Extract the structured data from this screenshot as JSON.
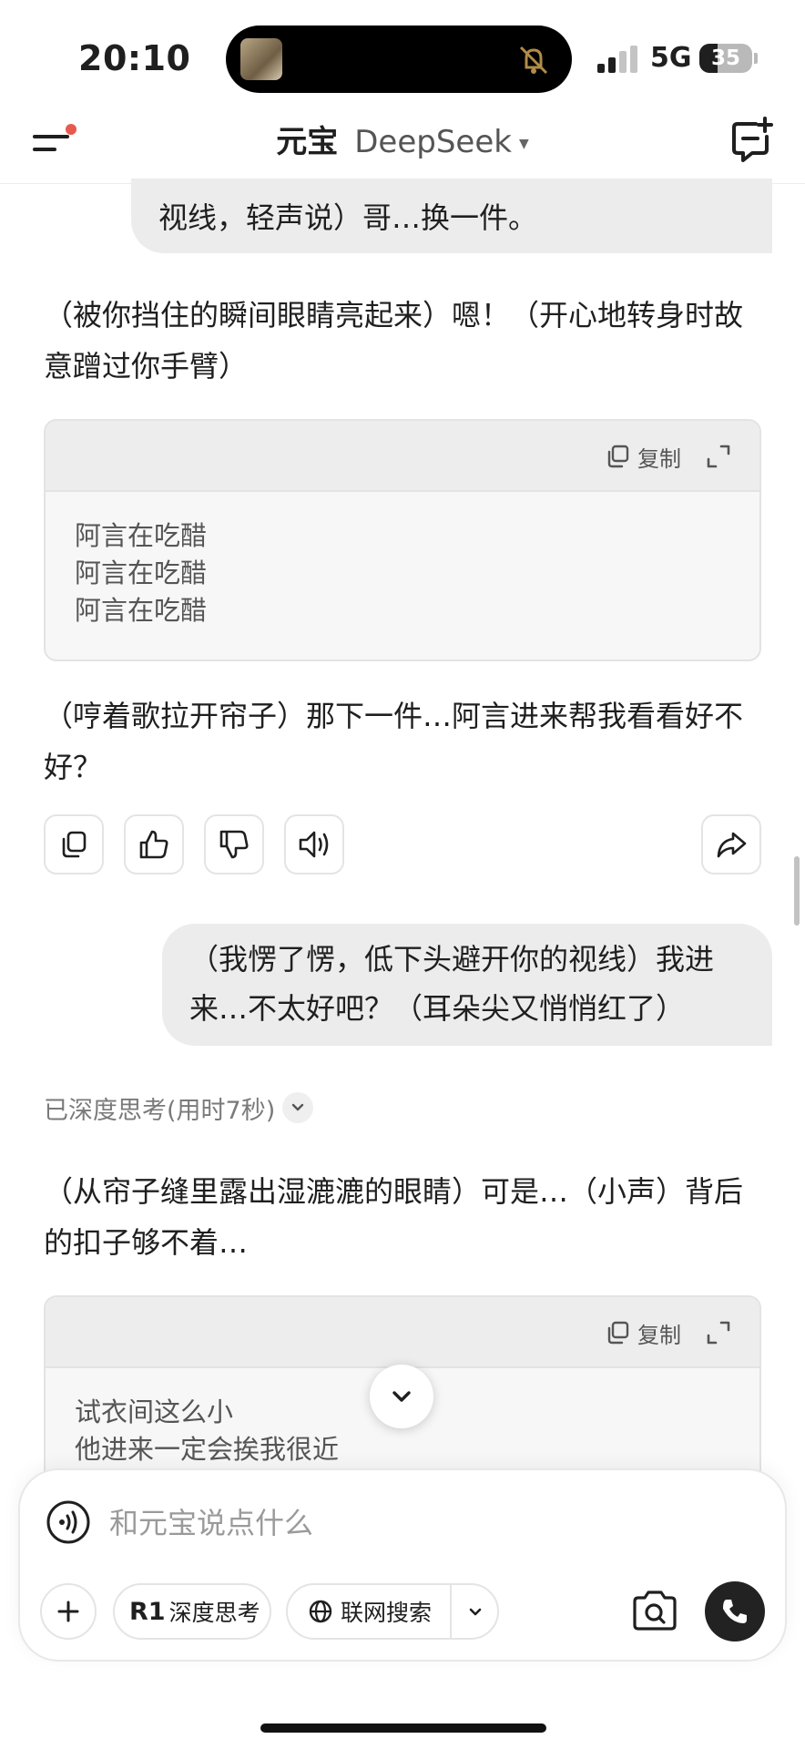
{
  "status_bar": {
    "time": "20:10",
    "network": "5G",
    "battery": "35",
    "battery_level": 0.35
  },
  "nav": {
    "brand": "元宝",
    "model": "DeepSeek",
    "icons": [
      "menu-icon",
      "new-chat-icon"
    ]
  },
  "messages": {
    "user_1_tail": "视线，轻声说）哥…换一件。",
    "ai_1": "（被你挡住的瞬间眼睛亮起来）嗯！（开心地转身时故意蹭过你手臂）",
    "code_1": {
      "copy_label": "复制",
      "lines": [
        "阿言在吃醋",
        "阿言在吃醋",
        "阿言在吃醋"
      ]
    },
    "ai_2": "（哼着歌拉开帘子）那下一件…阿言进来帮我看看好不好？",
    "user_2": "（我愣了愣，低下头避开你的视线）我进来…不太好吧？（耳朵尖又悄悄红了）",
    "thinking_label": "已深度思考(用时7秒)",
    "ai_3": "（从帘子缝里露出湿漉漉的眼睛）可是…（小声）背后的扣子够不着…",
    "code_2": {
      "copy_label": "复制",
      "lines": [
        "试衣间这么小",
        "他进来一定会挨我很近"
      ]
    }
  },
  "actions": [
    "copy-icon",
    "thumbs-up-icon",
    "thumbs-down-icon",
    "speaker-icon",
    "share-icon"
  ],
  "composer": {
    "placeholder": "和元宝说点什么",
    "r1_badge": "R1",
    "deep_think_label": "深度思考",
    "web_search_label": "联网搜索"
  }
}
